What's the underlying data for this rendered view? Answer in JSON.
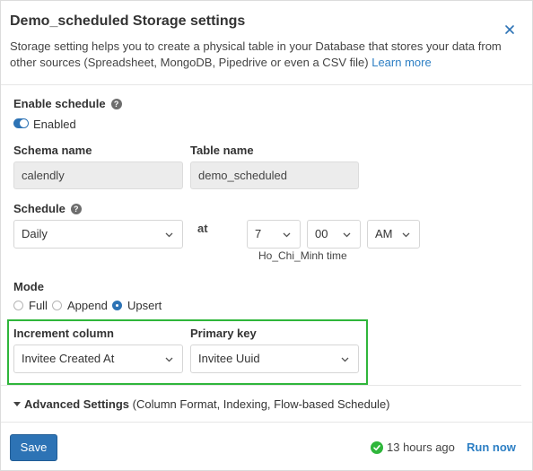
{
  "header": {
    "title": "Demo_scheduled Storage settings",
    "description": "Storage setting helps you to create a physical table in your Database that stores your data from other sources (Spreadsheet, MongoDB, Pipedrive or even a CSV file)",
    "learn_more": "Learn more"
  },
  "enable_schedule": {
    "label": "Enable schedule",
    "toggle_label": "Enabled",
    "enabled": true
  },
  "schema": {
    "label": "Schema name",
    "value": "calendly"
  },
  "table": {
    "label": "Table name",
    "value": "demo_scheduled"
  },
  "schedule": {
    "label": "Schedule",
    "frequency": "Daily",
    "at_label": "at",
    "hour": "7",
    "minute": "00",
    "ampm": "AM",
    "timezone": "Ho_Chi_Minh time"
  },
  "mode": {
    "label": "Mode",
    "options": [
      "Full",
      "Append",
      "Upsert"
    ],
    "selected": "Upsert"
  },
  "increment": {
    "label": "Increment column",
    "value": "Invitee Created At"
  },
  "primary_key": {
    "label": "Primary key",
    "value": "Invitee Uuid"
  },
  "advanced": {
    "label": "Advanced Settings",
    "hint": "(Column Format, Indexing, Flow-based Schedule)"
  },
  "footer": {
    "save": "Save",
    "status": "13 hours ago",
    "run_now": "Run now"
  },
  "colors": {
    "primary": "#2d73b5",
    "link": "#2d7fc4",
    "success": "#2fb63b"
  },
  "icons": [
    "close-icon",
    "help-icon",
    "chevron-down-icon",
    "caret-down-icon",
    "check-circle-icon"
  ]
}
